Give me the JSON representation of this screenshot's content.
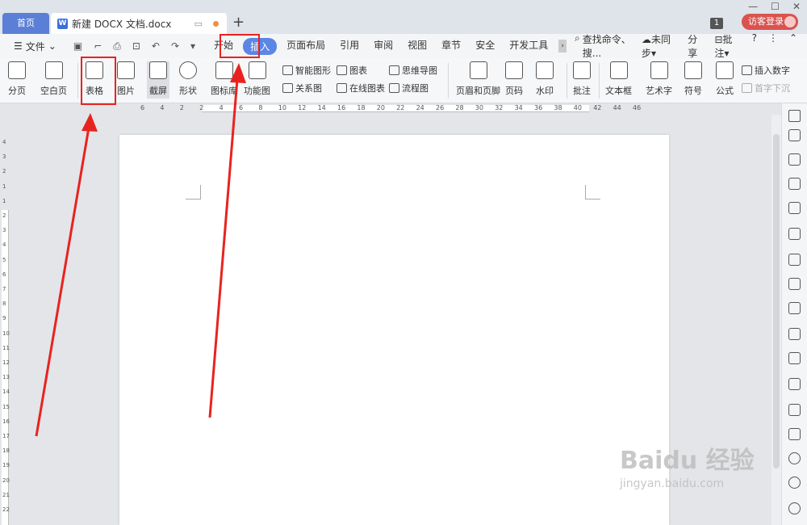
{
  "tabs": {
    "home": "首页",
    "doc": "新建 DOCX 文档.docx",
    "doc_icon": "W",
    "new_tab": "+"
  },
  "title_right": {
    "badge": "1",
    "login": "访客登录"
  },
  "menu": {
    "file": "文件",
    "items": [
      "开始",
      "插入",
      "页面布局",
      "引用",
      "审阅",
      "视图",
      "章节",
      "安全",
      "开发工具"
    ],
    "active": "插入",
    "search": "查找命令、搜...",
    "sync": "未同步",
    "share": "分享",
    "comment": "批注",
    "help": "?"
  },
  "ribbon": {
    "large": [
      "分页",
      "空白页",
      "表格",
      "图片",
      "截屏",
      "形状",
      "图标库",
      "功能图",
      "页眉和页脚",
      "页码",
      "水印",
      "批注",
      "文本框",
      "艺术字",
      "符号",
      "公式"
    ],
    "small": [
      "智能图形",
      "图表",
      "思维导图",
      "关系图",
      "在线图表",
      "流程图",
      "插入数字",
      "首字下沉"
    ]
  },
  "ruler": {
    "h": [
      "6",
      "4",
      "2",
      "2",
      "4",
      "6",
      "8",
      "10",
      "12",
      "14",
      "16",
      "18",
      "20",
      "22",
      "24",
      "26",
      "28",
      "30",
      "32",
      "34",
      "36",
      "38",
      "40",
      "42",
      "44",
      "46"
    ],
    "v": [
      "4",
      "3",
      "2",
      "1",
      "1",
      "2",
      "3",
      "4",
      "5",
      "6",
      "7",
      "8",
      "9",
      "10",
      "11",
      "12",
      "13",
      "14",
      "15",
      "16",
      "17",
      "18",
      "19",
      "20",
      "21",
      "22"
    ]
  },
  "watermark": {
    "brand": "Baidu 经验",
    "url": "jingyan.baidu.com"
  },
  "colors": {
    "accent": "#5b86e5",
    "highlight": "#e8231f",
    "tab_home": "#5b7fd6",
    "login": "#d9534f"
  }
}
